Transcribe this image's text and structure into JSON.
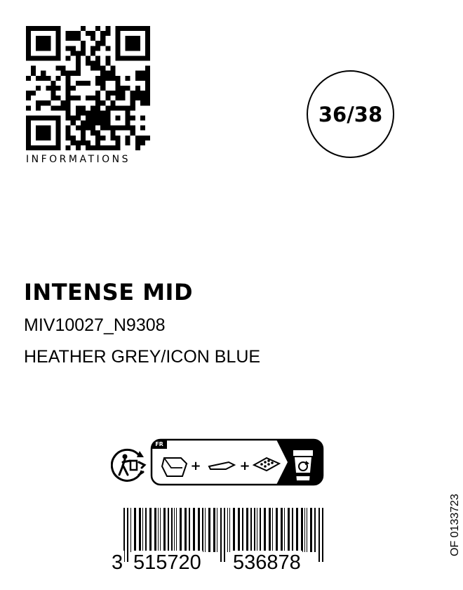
{
  "qr": {
    "caption": "INFORMATIONS",
    "icon": "qr-code-icon"
  },
  "size": "36/38",
  "product": {
    "name": "INTENSE MID",
    "reference": "MIV10027_N9308",
    "color": "HEATHER GREY/ICON BLUE"
  },
  "recycling": {
    "country": "FR",
    "plus_sign": "+",
    "icons": [
      "triman-icon",
      "pouch-icon",
      "label-tag-icon",
      "padded-card-icon",
      "recycling-bin-icon"
    ]
  },
  "barcode": {
    "first_digit": "3",
    "left_group": "515720",
    "right_group": "536878",
    "icon": "ean13-barcode-icon"
  },
  "vertical_code": "OF 0133723"
}
